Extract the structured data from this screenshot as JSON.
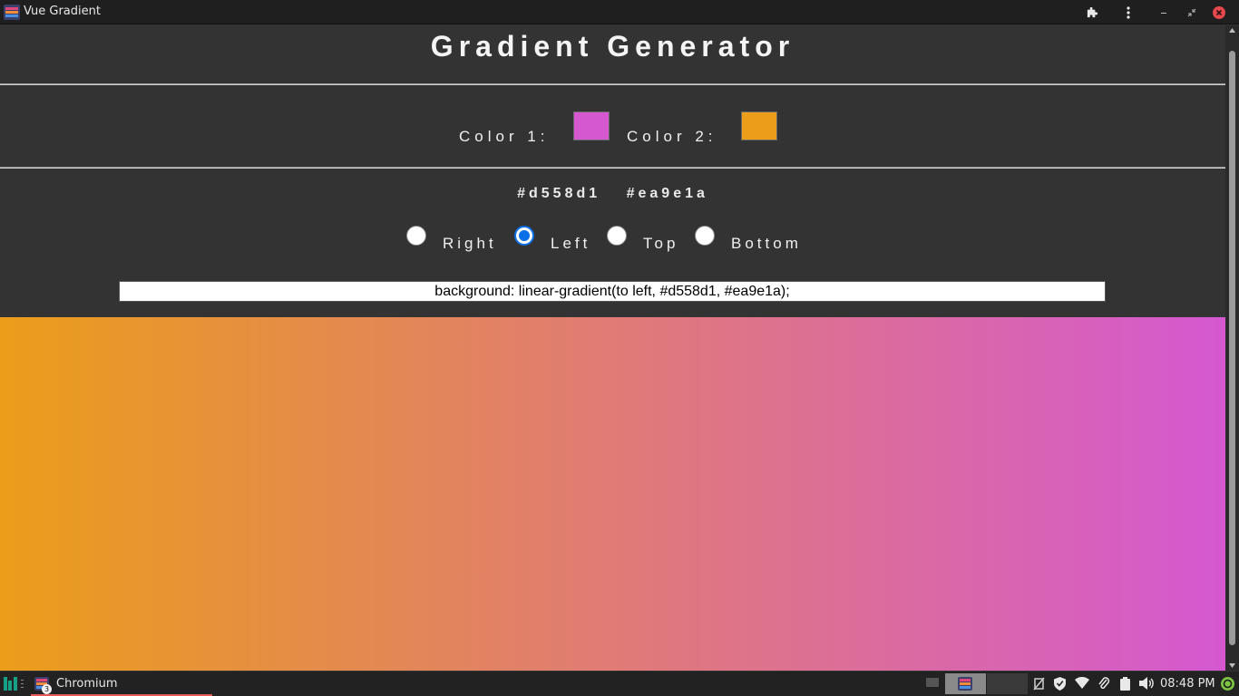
{
  "window": {
    "title": "Vue Gradient",
    "app_icon": "vue-gradient-app-icon",
    "buttons": [
      "extensions-icon",
      "menu-icon",
      "minimize-icon",
      "restore-icon",
      "close-icon"
    ]
  },
  "page": {
    "heading": "Gradient Generator",
    "color1_label": "Color 1:",
    "color1_value": "#d558d1",
    "color2_label": "Color 2:",
    "color2_value": "#ea9e1a",
    "hex1": "#d558d1",
    "hex2": "#ea9e1a",
    "directions": [
      {
        "label": "Right",
        "checked": false
      },
      {
        "label": "Left",
        "checked": true
      },
      {
        "label": "Top",
        "checked": false
      },
      {
        "label": "Bottom",
        "checked": false
      }
    ],
    "css_output": "background: linear-gradient(to left, #d558d1, #ea9e1a);",
    "accent_color": "#0b6fe6",
    "background_color": "#333333"
  },
  "taskbar": {
    "app_label": "Chromium",
    "window_count": "3",
    "clock": "08:48 PM",
    "tray_icons": [
      "network-off-icon",
      "shield-icon",
      "wifi-icon",
      "paperclip-icon",
      "clipboard-icon",
      "volume-icon",
      "update-icon"
    ]
  }
}
